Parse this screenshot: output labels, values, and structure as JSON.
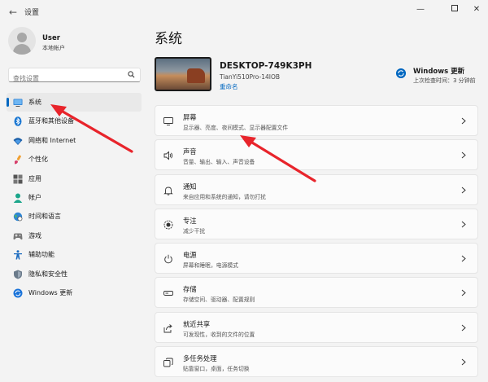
{
  "window": {
    "title": "设置",
    "back_glyph": "←",
    "minimize_glyph": "—",
    "close_glyph": "✕"
  },
  "user": {
    "name": "User",
    "account_type": "本地帐户"
  },
  "search": {
    "placeholder": "查找设置"
  },
  "sidebar": {
    "items": [
      {
        "label": "系统",
        "icon": "monitor-icon",
        "active": true
      },
      {
        "label": "蓝牙和其他设备",
        "icon": "bluetooth-icon"
      },
      {
        "label": "网络和 Internet",
        "icon": "wifi-icon"
      },
      {
        "label": "个性化",
        "icon": "brush-icon"
      },
      {
        "label": "应用",
        "icon": "apps-icon"
      },
      {
        "label": "帐户",
        "icon": "person-icon"
      },
      {
        "label": "时间和语言",
        "icon": "globe-clock-icon"
      },
      {
        "label": "游戏",
        "icon": "gamepad-icon"
      },
      {
        "label": "辅助功能",
        "icon": "accessibility-icon"
      },
      {
        "label": "隐私和安全性",
        "icon": "shield-icon"
      },
      {
        "label": "Windows 更新",
        "icon": "windows-update-icon"
      }
    ]
  },
  "main": {
    "title": "系统",
    "device": {
      "name": "DESKTOP-749K3PH",
      "model": "TianYi510Pro-14IOB",
      "rename": "重命名"
    },
    "update": {
      "title": "Windows 更新",
      "subtitle": "上次检查时间：3 分钟前"
    },
    "items": [
      {
        "title": "屏幕",
        "desc": "显示器、亮度、夜间模式、显示器配置文件",
        "icon": "display-icon"
      },
      {
        "title": "声音",
        "desc": "音量、输出、输入、声音设备",
        "icon": "speaker-icon"
      },
      {
        "title": "通知",
        "desc": "来自应用和系统的通知，请勿打扰",
        "icon": "bell-icon"
      },
      {
        "title": "专注",
        "desc": "减少干扰",
        "icon": "focus-icon"
      },
      {
        "title": "电源",
        "desc": "屏幕和睡眠，电源模式",
        "icon": "power-icon"
      },
      {
        "title": "存储",
        "desc": "存储空间、驱动器、配置规则",
        "icon": "storage-icon"
      },
      {
        "title": "就近共享",
        "desc": "可发现性，收到的文件的位置",
        "icon": "share-icon"
      },
      {
        "title": "多任务处理",
        "desc": "贴靠窗口，桌面，任务切换",
        "icon": "multitask-icon"
      }
    ]
  },
  "colors": {
    "accent": "#0067c0",
    "annotation": "#e8242b",
    "background": "#f3f3f3"
  }
}
